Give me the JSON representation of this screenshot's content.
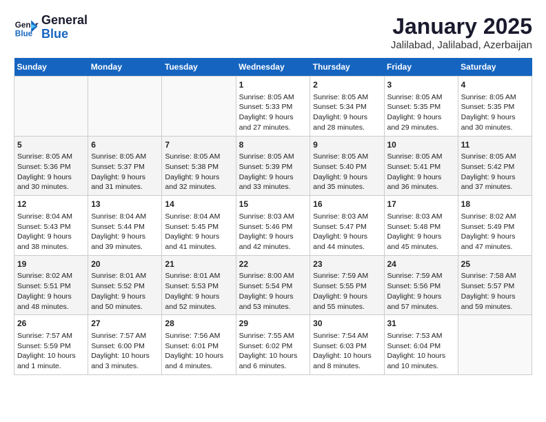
{
  "header": {
    "logo_line1": "General",
    "logo_line2": "Blue",
    "title": "January 2025",
    "subtitle": "Jalilabad, Jalilabad, Azerbaijan"
  },
  "columns": [
    "Sunday",
    "Monday",
    "Tuesday",
    "Wednesday",
    "Thursday",
    "Friday",
    "Saturday"
  ],
  "weeks": [
    [
      {
        "day": "",
        "info": ""
      },
      {
        "day": "",
        "info": ""
      },
      {
        "day": "",
        "info": ""
      },
      {
        "day": "1",
        "info": "Sunrise: 8:05 AM\nSunset: 5:33 PM\nDaylight: 9 hours and 27 minutes."
      },
      {
        "day": "2",
        "info": "Sunrise: 8:05 AM\nSunset: 5:34 PM\nDaylight: 9 hours and 28 minutes."
      },
      {
        "day": "3",
        "info": "Sunrise: 8:05 AM\nSunset: 5:35 PM\nDaylight: 9 hours and 29 minutes."
      },
      {
        "day": "4",
        "info": "Sunrise: 8:05 AM\nSunset: 5:35 PM\nDaylight: 9 hours and 30 minutes."
      }
    ],
    [
      {
        "day": "5",
        "info": "Sunrise: 8:05 AM\nSunset: 5:36 PM\nDaylight: 9 hours and 30 minutes."
      },
      {
        "day": "6",
        "info": "Sunrise: 8:05 AM\nSunset: 5:37 PM\nDaylight: 9 hours and 31 minutes."
      },
      {
        "day": "7",
        "info": "Sunrise: 8:05 AM\nSunset: 5:38 PM\nDaylight: 9 hours and 32 minutes."
      },
      {
        "day": "8",
        "info": "Sunrise: 8:05 AM\nSunset: 5:39 PM\nDaylight: 9 hours and 33 minutes."
      },
      {
        "day": "9",
        "info": "Sunrise: 8:05 AM\nSunset: 5:40 PM\nDaylight: 9 hours and 35 minutes."
      },
      {
        "day": "10",
        "info": "Sunrise: 8:05 AM\nSunset: 5:41 PM\nDaylight: 9 hours and 36 minutes."
      },
      {
        "day": "11",
        "info": "Sunrise: 8:05 AM\nSunset: 5:42 PM\nDaylight: 9 hours and 37 minutes."
      }
    ],
    [
      {
        "day": "12",
        "info": "Sunrise: 8:04 AM\nSunset: 5:43 PM\nDaylight: 9 hours and 38 minutes."
      },
      {
        "day": "13",
        "info": "Sunrise: 8:04 AM\nSunset: 5:44 PM\nDaylight: 9 hours and 39 minutes."
      },
      {
        "day": "14",
        "info": "Sunrise: 8:04 AM\nSunset: 5:45 PM\nDaylight: 9 hours and 41 minutes."
      },
      {
        "day": "15",
        "info": "Sunrise: 8:03 AM\nSunset: 5:46 PM\nDaylight: 9 hours and 42 minutes."
      },
      {
        "day": "16",
        "info": "Sunrise: 8:03 AM\nSunset: 5:47 PM\nDaylight: 9 hours and 44 minutes."
      },
      {
        "day": "17",
        "info": "Sunrise: 8:03 AM\nSunset: 5:48 PM\nDaylight: 9 hours and 45 minutes."
      },
      {
        "day": "18",
        "info": "Sunrise: 8:02 AM\nSunset: 5:49 PM\nDaylight: 9 hours and 47 minutes."
      }
    ],
    [
      {
        "day": "19",
        "info": "Sunrise: 8:02 AM\nSunset: 5:51 PM\nDaylight: 9 hours and 48 minutes."
      },
      {
        "day": "20",
        "info": "Sunrise: 8:01 AM\nSunset: 5:52 PM\nDaylight: 9 hours and 50 minutes."
      },
      {
        "day": "21",
        "info": "Sunrise: 8:01 AM\nSunset: 5:53 PM\nDaylight: 9 hours and 52 minutes."
      },
      {
        "day": "22",
        "info": "Sunrise: 8:00 AM\nSunset: 5:54 PM\nDaylight: 9 hours and 53 minutes."
      },
      {
        "day": "23",
        "info": "Sunrise: 7:59 AM\nSunset: 5:55 PM\nDaylight: 9 hours and 55 minutes."
      },
      {
        "day": "24",
        "info": "Sunrise: 7:59 AM\nSunset: 5:56 PM\nDaylight: 9 hours and 57 minutes."
      },
      {
        "day": "25",
        "info": "Sunrise: 7:58 AM\nSunset: 5:57 PM\nDaylight: 9 hours and 59 minutes."
      }
    ],
    [
      {
        "day": "26",
        "info": "Sunrise: 7:57 AM\nSunset: 5:59 PM\nDaylight: 10 hours and 1 minute."
      },
      {
        "day": "27",
        "info": "Sunrise: 7:57 AM\nSunset: 6:00 PM\nDaylight: 10 hours and 3 minutes."
      },
      {
        "day": "28",
        "info": "Sunrise: 7:56 AM\nSunset: 6:01 PM\nDaylight: 10 hours and 4 minutes."
      },
      {
        "day": "29",
        "info": "Sunrise: 7:55 AM\nSunset: 6:02 PM\nDaylight: 10 hours and 6 minutes."
      },
      {
        "day": "30",
        "info": "Sunrise: 7:54 AM\nSunset: 6:03 PM\nDaylight: 10 hours and 8 minutes."
      },
      {
        "day": "31",
        "info": "Sunrise: 7:53 AM\nSunset: 6:04 PM\nDaylight: 10 hours and 10 minutes."
      },
      {
        "day": "",
        "info": ""
      }
    ]
  ]
}
